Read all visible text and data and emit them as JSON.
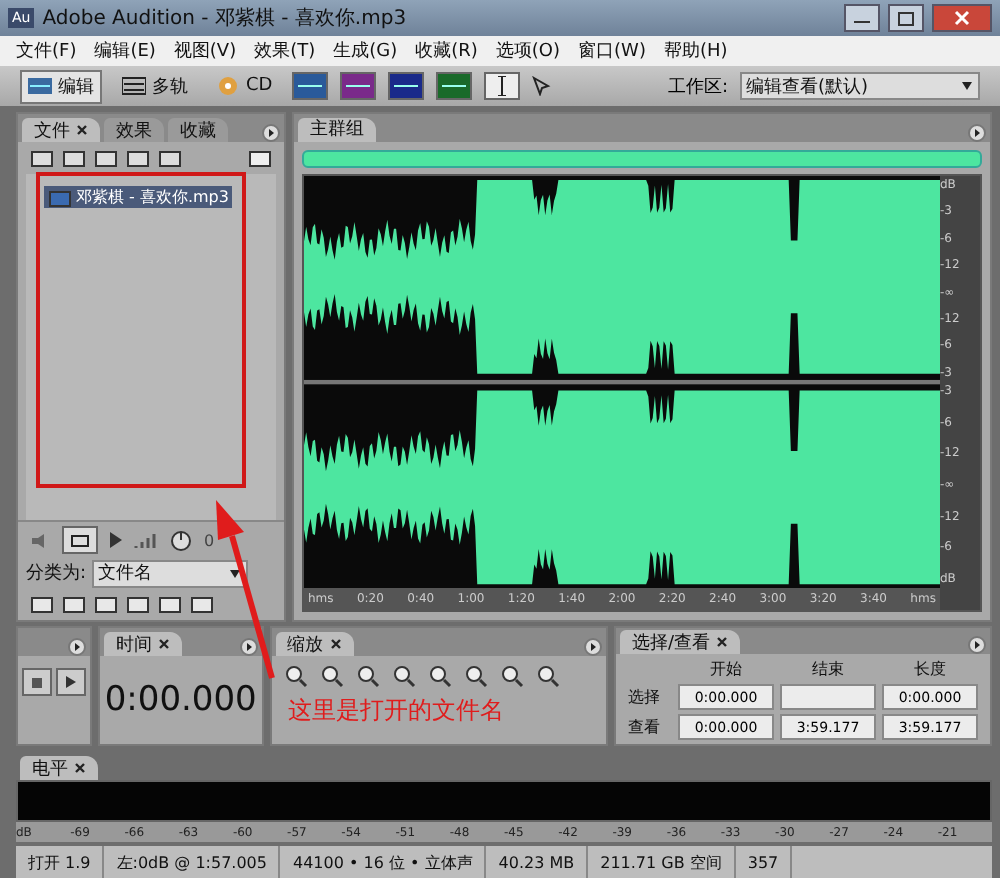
{
  "window": {
    "title": "Adobe Audition - 邓紫棋 - 喜欢你.mp3",
    "app_icon": "Au"
  },
  "menu": [
    "文件(F)",
    "编辑(E)",
    "视图(V)",
    "效果(T)",
    "生成(G)",
    "收藏(R)",
    "选项(O)",
    "窗口(W)",
    "帮助(H)"
  ],
  "toolbar": {
    "modes": [
      {
        "label": "编辑",
        "selected": true
      },
      {
        "label": "多轨",
        "selected": false
      },
      {
        "label": "CD",
        "selected": false
      }
    ],
    "workspace_label": "工作区:",
    "workspace_value": "编辑查看(默认)"
  },
  "files_panel": {
    "tabs": [
      {
        "label": "文件",
        "selected": true
      },
      {
        "label": "效果",
        "selected": false
      },
      {
        "label": "收藏",
        "selected": false
      }
    ],
    "items": [
      {
        "name": "邓紫棋 - 喜欢你.mp3",
        "selected": true
      }
    ],
    "volume": "0",
    "sort_label": "分类为:",
    "sort_value": "文件名"
  },
  "main_group": {
    "tab": "主群组",
    "channels": [
      {
        "scale": [
          "dB",
          "-3",
          "-6",
          "-12",
          "-∞",
          "-12",
          "-6",
          "-3"
        ]
      },
      {
        "scale": [
          "-3",
          "-6",
          "-12",
          "-∞",
          "-12",
          "-6",
          "dB"
        ]
      }
    ],
    "ruler": [
      "hms",
      "0:20",
      "0:40",
      "1:00",
      "1:20",
      "1:40",
      "2:00",
      "2:20",
      "2:40",
      "3:00",
      "3:20",
      "3:40",
      "hms"
    ]
  },
  "time_panel": {
    "tab": "时间",
    "value": "0:00.000"
  },
  "zoom_panel": {
    "tab": "缩放"
  },
  "selection_panel": {
    "tab": "选择/查看",
    "columns": [
      "开始",
      "结束",
      "长度"
    ],
    "rows": [
      {
        "label": "选择",
        "start": "0:00.000",
        "length": "0:00.000"
      },
      {
        "label": "查看",
        "start": "0:00.000",
        "end": "3:59.177",
        "length": "3:59.177"
      }
    ]
  },
  "level_panel": {
    "tab": "电平",
    "scale": [
      "dB",
      "-69",
      "-66",
      "-63",
      "-60",
      "-57",
      "-54",
      "-51",
      "-48",
      "-45",
      "-42",
      "-39",
      "-36",
      "-33",
      "-30",
      "-27",
      "-24",
      "-21"
    ]
  },
  "status_bar": [
    "打开 1.9",
    "左:0dB @ 1:57.005",
    "44100 • 16 位 • 立体声",
    "40.23 MB",
    "211.71 GB 空间",
    "357"
  ],
  "annotation": {
    "text": "这里是打开的文件名"
  }
}
